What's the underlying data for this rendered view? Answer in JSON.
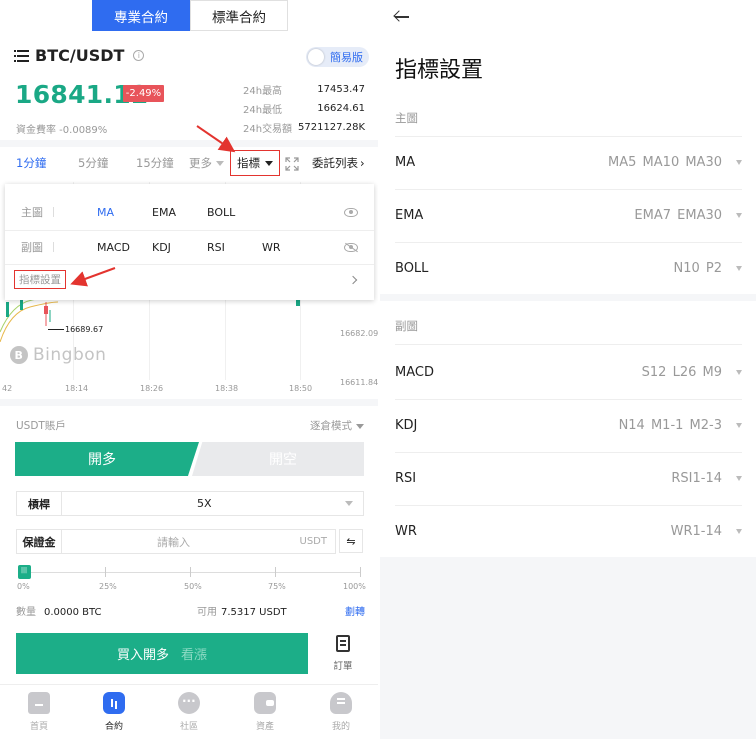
{
  "top_tabs": [
    "專業合約",
    "標準合約"
  ],
  "pair": {
    "name": "BTC/USDT",
    "simple_mode": "簡易版",
    "last_price": "16841.12",
    "change": "-2.49%",
    "funding_rate": "資金費率 -0.0089%"
  },
  "stats": [
    {
      "label": "24h最高",
      "value": "17453.47"
    },
    {
      "label": "24h最低",
      "value": "16624.61"
    },
    {
      "label": "24h交易額",
      "value": "5721127.28K"
    }
  ],
  "timebar": {
    "m1": "1分鐘",
    "m5": "5分鐘",
    "m15": "15分鐘",
    "more": "更多",
    "indicator": "指標",
    "orders": "委託列表"
  },
  "chart": {
    "y_labels": [
      "16682.09",
      "16611.84"
    ],
    "x_labels": [
      "42",
      "18:14",
      "18:26",
      "18:38",
      "18:50"
    ],
    "low_marker": "16689.67",
    "watermark": "Bingbon"
  },
  "indicator_popup": {
    "main_label": "主圖",
    "main_options": [
      "MA",
      "EMA",
      "BOLL"
    ],
    "sub_label": "副圖",
    "sub_options": [
      "MACD",
      "KDJ",
      "RSI",
      "WR"
    ],
    "settings_label": "指標設置"
  },
  "trade": {
    "account": "USDT賬戶",
    "mode": "逐倉模式",
    "long": "開多",
    "short": "開空",
    "leverage_label": "槓桿",
    "leverage_value": "5X",
    "margin_label": "保證金",
    "margin_placeholder": "請輸入",
    "margin_unit": "USDT",
    "slider_labels": [
      "0%",
      "25%",
      "50%",
      "75%",
      "100%"
    ],
    "qty_label": "數量",
    "qty_value": "0.0000 BTC",
    "available_label": "可用",
    "available_value": "7.5317 USDT",
    "transfer": "劃轉",
    "buy_label": "買入開多",
    "buy_sub": "看漲",
    "orders_label": "訂單"
  },
  "tabbar": [
    {
      "label": "首頁",
      "icon": "home-icon"
    },
    {
      "label": "合約",
      "icon": "contract-icon"
    },
    {
      "label": "社區",
      "icon": "community-icon"
    },
    {
      "label": "資產",
      "icon": "wallet-icon"
    },
    {
      "label": "我的",
      "icon": "profile-icon"
    }
  ],
  "settings": {
    "title": "指標設置",
    "main_section": "主圖",
    "main_rows": [
      {
        "name": "MA",
        "value": "MA5 MA10 MA30"
      },
      {
        "name": "EMA",
        "value": "EMA7 EMA30"
      },
      {
        "name": "BOLL",
        "value": "N10 P2"
      }
    ],
    "sub_section": "副圖",
    "sub_rows": [
      {
        "name": "MACD",
        "value": "S12 L26 M9"
      },
      {
        "name": "KDJ",
        "value": "N14 M1-1 M2-3"
      },
      {
        "name": "RSI",
        "value": "RSI1-14"
      },
      {
        "name": "WR",
        "value": "WR1-14"
      }
    ]
  },
  "colors": {
    "accent_blue": "#2f6cf0",
    "up_green": "#1aa885",
    "down_red": "#e8545a",
    "annotation_red": "#e3342f"
  }
}
